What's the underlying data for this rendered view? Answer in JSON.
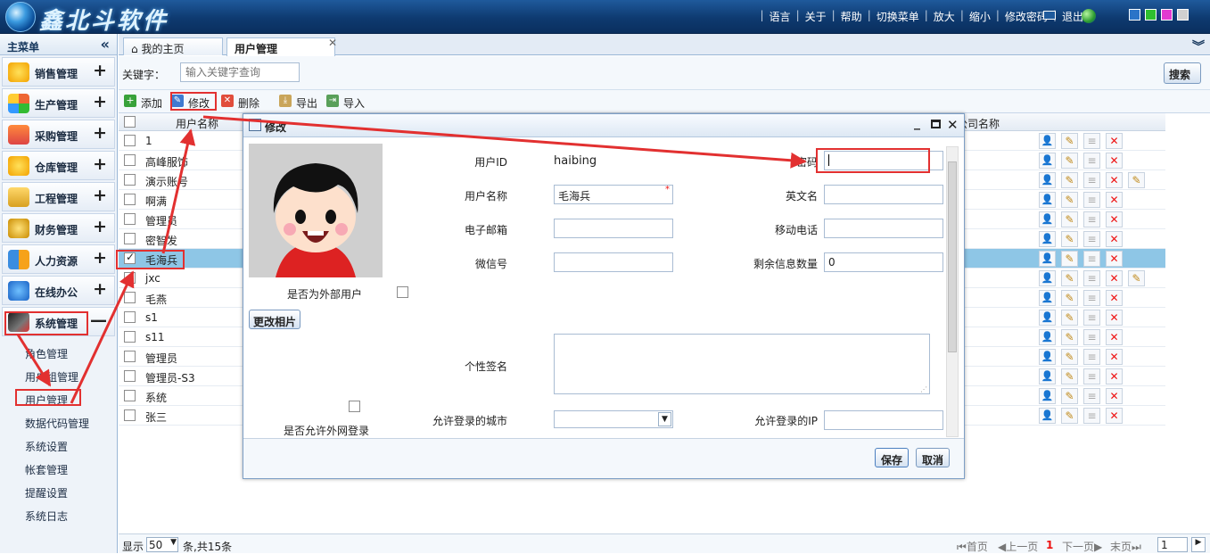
{
  "app": {
    "title": "鑫北斗软件"
  },
  "topnav": [
    "语言",
    "关于",
    "帮助",
    "切换菜单",
    "放大",
    "缩小",
    "修改密码",
    "退出"
  ],
  "theme_colors": [
    "#2b74c8",
    "#2fbf2f",
    "#e23ad1",
    "#d0d0d0"
  ],
  "sidebar": {
    "title": "主菜单",
    "menus": [
      {
        "label": "销售管理",
        "icon": "star-icon",
        "sign": "+"
      },
      {
        "label": "生产管理",
        "icon": "globe-icon",
        "sign": "+"
      },
      {
        "label": "采购管理",
        "icon": "cart-icon",
        "sign": "+"
      },
      {
        "label": "仓库管理",
        "icon": "star-icon",
        "sign": "+"
      },
      {
        "label": "工程管理",
        "icon": "notebook-icon",
        "sign": "+"
      },
      {
        "label": "财务管理",
        "icon": "coins-icon",
        "sign": "+"
      },
      {
        "label": "人力资源",
        "icon": "people-icon",
        "sign": "+"
      },
      {
        "label": "在线办公",
        "icon": "email-icon",
        "sign": "+"
      },
      {
        "label": "系统管理",
        "icon": "tools-icon",
        "sign": "—"
      }
    ],
    "subitems": [
      "角色管理",
      "用户组管理",
      "用户管理",
      "数据代码管理",
      "系统设置",
      "帐套管理",
      "提醒设置",
      "系统日志"
    ]
  },
  "tabs": [
    {
      "label": "我的主页"
    },
    {
      "label": "用户管理"
    }
  ],
  "search": {
    "label": "关键字：",
    "placeholder": "输入关键字查询",
    "button": "搜索"
  },
  "toolbar": {
    "add": "添加",
    "edit": "修改",
    "delete": "删除",
    "export": "导出",
    "import": "导入"
  },
  "grid": {
    "col_username": "用户名称",
    "col_company": "公司名称",
    "rows": [
      {
        "name": "1",
        "checked": false,
        "extra": false
      },
      {
        "name": "高峰服饰",
        "checked": false,
        "extra": false
      },
      {
        "name": "演示账号",
        "checked": false,
        "extra": true
      },
      {
        "name": "啊满",
        "checked": false,
        "extra": false
      },
      {
        "name": "管理员",
        "checked": false,
        "extra": false
      },
      {
        "name": "密智发",
        "checked": false,
        "extra": false
      },
      {
        "name": "毛海兵",
        "checked": true,
        "extra": false,
        "selected": true
      },
      {
        "name": "jxc",
        "checked": false,
        "extra": true
      },
      {
        "name": "毛燕",
        "checked": false,
        "extra": false
      },
      {
        "name": "s1",
        "checked": false,
        "extra": false
      },
      {
        "name": "s11",
        "checked": false,
        "extra": false
      },
      {
        "name": "管理员",
        "checked": false,
        "extra": false
      },
      {
        "name": "管理员-S3",
        "checked": false,
        "extra": false
      },
      {
        "name": "系统",
        "checked": false,
        "extra": false
      },
      {
        "name": "张三",
        "checked": false,
        "extra": false
      }
    ]
  },
  "pager": {
    "show": "显示",
    "page_size": "50",
    "total": "条,共15条",
    "first": "首页",
    "prev": "上一页",
    "current": "1",
    "next": "下一页",
    "last": "末页",
    "goto": "1"
  },
  "modal": {
    "title": "修改",
    "user_id_label": "用户ID",
    "user_id_value": "haibing",
    "password_label": "密码",
    "username_label": "用户名称",
    "username_value": "毛海兵",
    "english_label": "英文名",
    "email_label": "电子邮箱",
    "mobile_label": "移动电话",
    "wechat_label": "微信号",
    "remaining_label": "剩余信息数量",
    "remaining_value": "0",
    "external_user_label": "是否为外部用户",
    "change_photo": "更改相片",
    "signature_label": "个性签名",
    "allow_external_label": "是否允许外网登录",
    "allow_city_label": "允许登录的城市",
    "allow_ip_label": "允许登录的IP",
    "save": "保存",
    "cancel": "取消"
  }
}
